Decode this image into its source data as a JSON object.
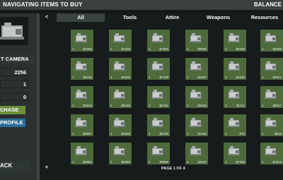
{
  "header": {
    "title": "NAVIGATING ITEMS TO BUY",
    "balance": "BALANCE"
  },
  "left_panel": {
    "item_name": "T CAMERA",
    "price": "2256",
    "quantity": "1",
    "total": "0",
    "purchase_label": "CHASE",
    "profile_label": "PROFILE",
    "back_label": "ACK"
  },
  "tabs": {
    "back_arrow": "<",
    "items": [
      {
        "label": "All",
        "active": true
      },
      {
        "label": "Tools"
      },
      {
        "label": "Attire"
      },
      {
        "label": "Weapons"
      },
      {
        "label": "Resources"
      }
    ]
  },
  "grid": {
    "items": [
      {
        "qty": "1",
        "price": "$2256"
      },
      {
        "qty": "1",
        "price": "$7239"
      },
      {
        "qty": "1",
        "price": "$7966"
      },
      {
        "qty": "1",
        "price": "$9585"
      },
      {
        "qty": "1",
        "price": "$5458"
      },
      {
        "qty": "1",
        "price": "$2608"
      },
      {
        "qty": "1",
        "price": "$6768"
      },
      {
        "qty": "1",
        "price": "$4506"
      },
      {
        "qty": "1",
        "price": "$7408"
      },
      {
        "qty": "1",
        "price": "$2337"
      },
      {
        "qty": "1",
        "price": "$1536"
      },
      {
        "qty": "1",
        "price": "$2621"
      },
      {
        "qty": "1",
        "price": "$2616"
      },
      {
        "qty": "1",
        "price": "$8198"
      },
      {
        "qty": "1",
        "price": "$2751"
      },
      {
        "qty": "1",
        "price": "$9433"
      },
      {
        "qty": "1",
        "price": "$1101"
      },
      {
        "qty": "1",
        "price": "$9817"
      },
      {
        "qty": "1",
        "price": "$8967"
      },
      {
        "qty": "1",
        "price": "$4539"
      },
      {
        "qty": "1",
        "price": "$5790"
      },
      {
        "qty": "1",
        "price": "$2300"
      },
      {
        "qty": "1",
        "price": "$76"
      },
      {
        "qty": "1",
        "price": "$516"
      },
      {
        "qty": "1",
        "price": "$6882"
      },
      {
        "qty": "1",
        "price": "$8358"
      },
      {
        "qty": "1",
        "price": "$5990"
      },
      {
        "qty": "1",
        "price": "$2627"
      },
      {
        "qty": "1",
        "price": "$7458"
      },
      {
        "qty": "1",
        "price": "$1915"
      }
    ],
    "item_icon": "camera-icon"
  },
  "pager": {
    "text": "PAGE 1 OF 4",
    "left_arrow": "<"
  }
}
